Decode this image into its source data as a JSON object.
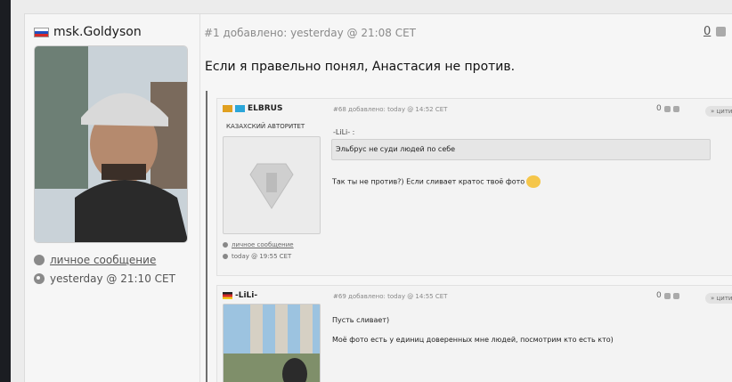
{
  "post": {
    "username": "msk.Goldyson",
    "meta": "#1 добавлено: yesterday @ 21:08 CET",
    "text": "Если я правельно понял, Анастасия не против.",
    "vote_count": "0",
    "private_message": "личное сообщение",
    "last_seen": "yesterday @ 21:10 CET"
  },
  "quotes": [
    {
      "username": "ELBRUS",
      "rank": "КАЗАХСКИЙ АВТОРИТЕТ",
      "meta": "#68 добавлено: today @ 14:52 CET",
      "vote_count": "0",
      "cite_label": "» цити",
      "private_message": "личное сообщение",
      "last_seen": "today @ 19:55 CET",
      "quoted_author": "-LiLi- :",
      "quoted_text": "Эльбрус не суди людей по себе",
      "reply": "Так ты не против?) Если сливает кратос твоё фото"
    },
    {
      "username": "-LiLi-",
      "meta": "#69 добавлено: today @ 14:55 CET",
      "vote_count": "0",
      "cite_label": "» цити",
      "reply_line1": "Пусть сливает)",
      "reply_line2": "Моё фото есть у единиц доверенных мне людей, посмотрим кто есть кто)"
    }
  ],
  "colors": {
    "background": "#1b1d22",
    "panel": "#f6f6f6",
    "quote_box": "#e6e6e6",
    "meta_text": "#8a8a8a"
  }
}
